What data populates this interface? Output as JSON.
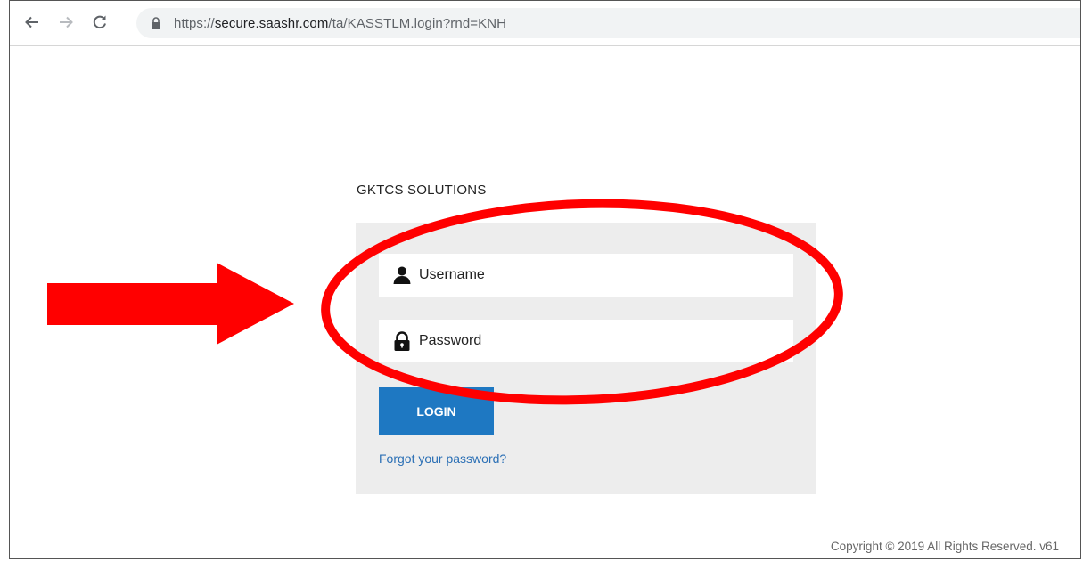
{
  "browser": {
    "url": {
      "protocol": "https://",
      "host": "secure.saashr.com",
      "path": "/ta/KASSTLM.login?rnd=KNH"
    },
    "icons": [
      "back-icon",
      "forward-icon",
      "reload-icon",
      "lock-icon"
    ]
  },
  "page": {
    "company_name": "GKTCS SOLUTIONS",
    "username_placeholder": "Username",
    "password_placeholder": "Password",
    "login_label": "LOGIN",
    "forgot_link": "Forgot your password?",
    "copyright": "Copyright © 2019 All Rights Reserved. v61"
  },
  "annotations": {
    "arrow_color": "#ff0000",
    "ellipse_color": "#ff0000"
  },
  "colors": {
    "login_button": "#1e78c2",
    "link": "#2a6fb5",
    "panel": "#ededed"
  }
}
